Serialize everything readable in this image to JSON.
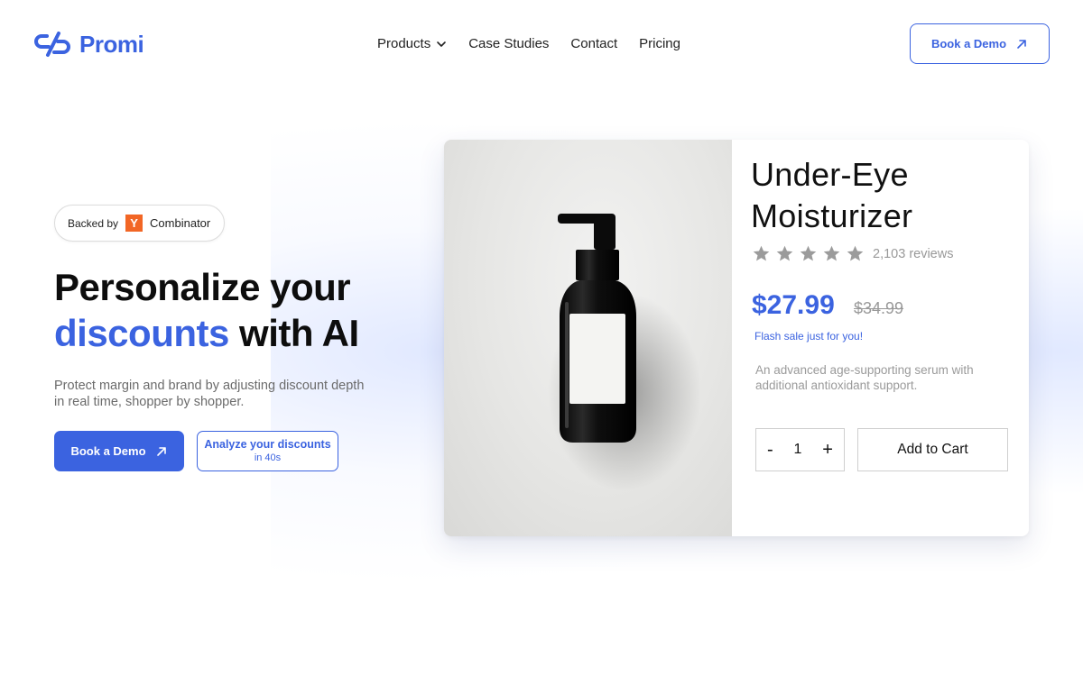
{
  "brand": {
    "name": "Promi",
    "color": "#3b63e0"
  },
  "nav": {
    "items": [
      {
        "label": "Products",
        "has_dropdown": true
      },
      {
        "label": "Case Studies"
      },
      {
        "label": "Contact"
      },
      {
        "label": "Pricing"
      }
    ]
  },
  "header": {
    "cta_label": "Book a Demo",
    "cta_icon": "arrow-up-right-icon"
  },
  "hero": {
    "badge": {
      "prefix": "Backed by",
      "logo_letter": "Y",
      "name": "Combinator",
      "logo_color": "#f26625"
    },
    "headline_line1": "Personalize your",
    "headline_accent": "discounts",
    "headline_rest": " with AI",
    "subtitle": "Protect margin and brand by adjusting discount depth in real time, shopper by shopper.",
    "primary_cta": "Book a Demo",
    "secondary_cta_line1": "Analyze your discounts",
    "secondary_cta_line2": "in 40s"
  },
  "product": {
    "title": "Under-Eye Moisturizer",
    "rating": 5,
    "reviews": "2,103 reviews",
    "price": "$27.99",
    "old_price": "$34.99",
    "flash": "Flash sale just for you!",
    "description": "An advanced age-supporting serum with additional antioxidant support.",
    "quantity": "1",
    "minus": "-",
    "plus": "+",
    "add_to_cart": "Add to Cart"
  }
}
